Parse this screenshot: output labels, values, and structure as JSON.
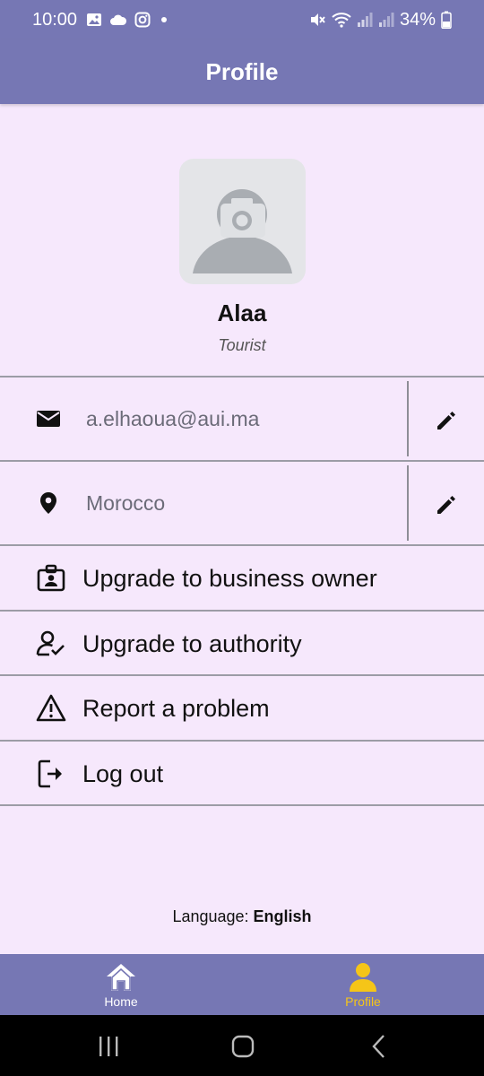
{
  "status_bar": {
    "time": "10:00",
    "battery": "34%",
    "icons": [
      "image-icon",
      "cloud-icon",
      "instagram-icon",
      "dot-icon",
      "mute-icon",
      "wifi-icon",
      "signal-icon",
      "signal-icon",
      "battery-icon"
    ]
  },
  "app_bar": {
    "title": "Profile"
  },
  "profile": {
    "avatar_icon": "camera-icon",
    "name": "Alaa",
    "role": "Tourist"
  },
  "fields": {
    "email": {
      "value": "a.elhaoua@aui.ma",
      "icon": "mail-icon",
      "edit_icon": "pencil-icon"
    },
    "location": {
      "value": "Morocco",
      "icon": "location-pin-icon",
      "edit_icon": "pencil-icon"
    }
  },
  "menu": {
    "upgrade_business": {
      "label": "Upgrade to business owner",
      "icon": "id-badge-icon"
    },
    "upgrade_authority": {
      "label": "Upgrade to authority",
      "icon": "user-check-icon"
    },
    "report_problem": {
      "label": "Report a problem",
      "icon": "warning-icon"
    },
    "logout": {
      "label": "Log out",
      "icon": "logout-icon"
    }
  },
  "language": {
    "label": "Language: ",
    "value": "English"
  },
  "bottom_nav": {
    "home": {
      "label": "Home",
      "icon": "home-icon"
    },
    "profile": {
      "label": "Profile",
      "icon": "person-icon"
    }
  },
  "colors": {
    "primary": "#7677b4",
    "background": "#f6e8fc",
    "active_nav": "#f5c518",
    "inactive_nav": "#ffffff"
  }
}
